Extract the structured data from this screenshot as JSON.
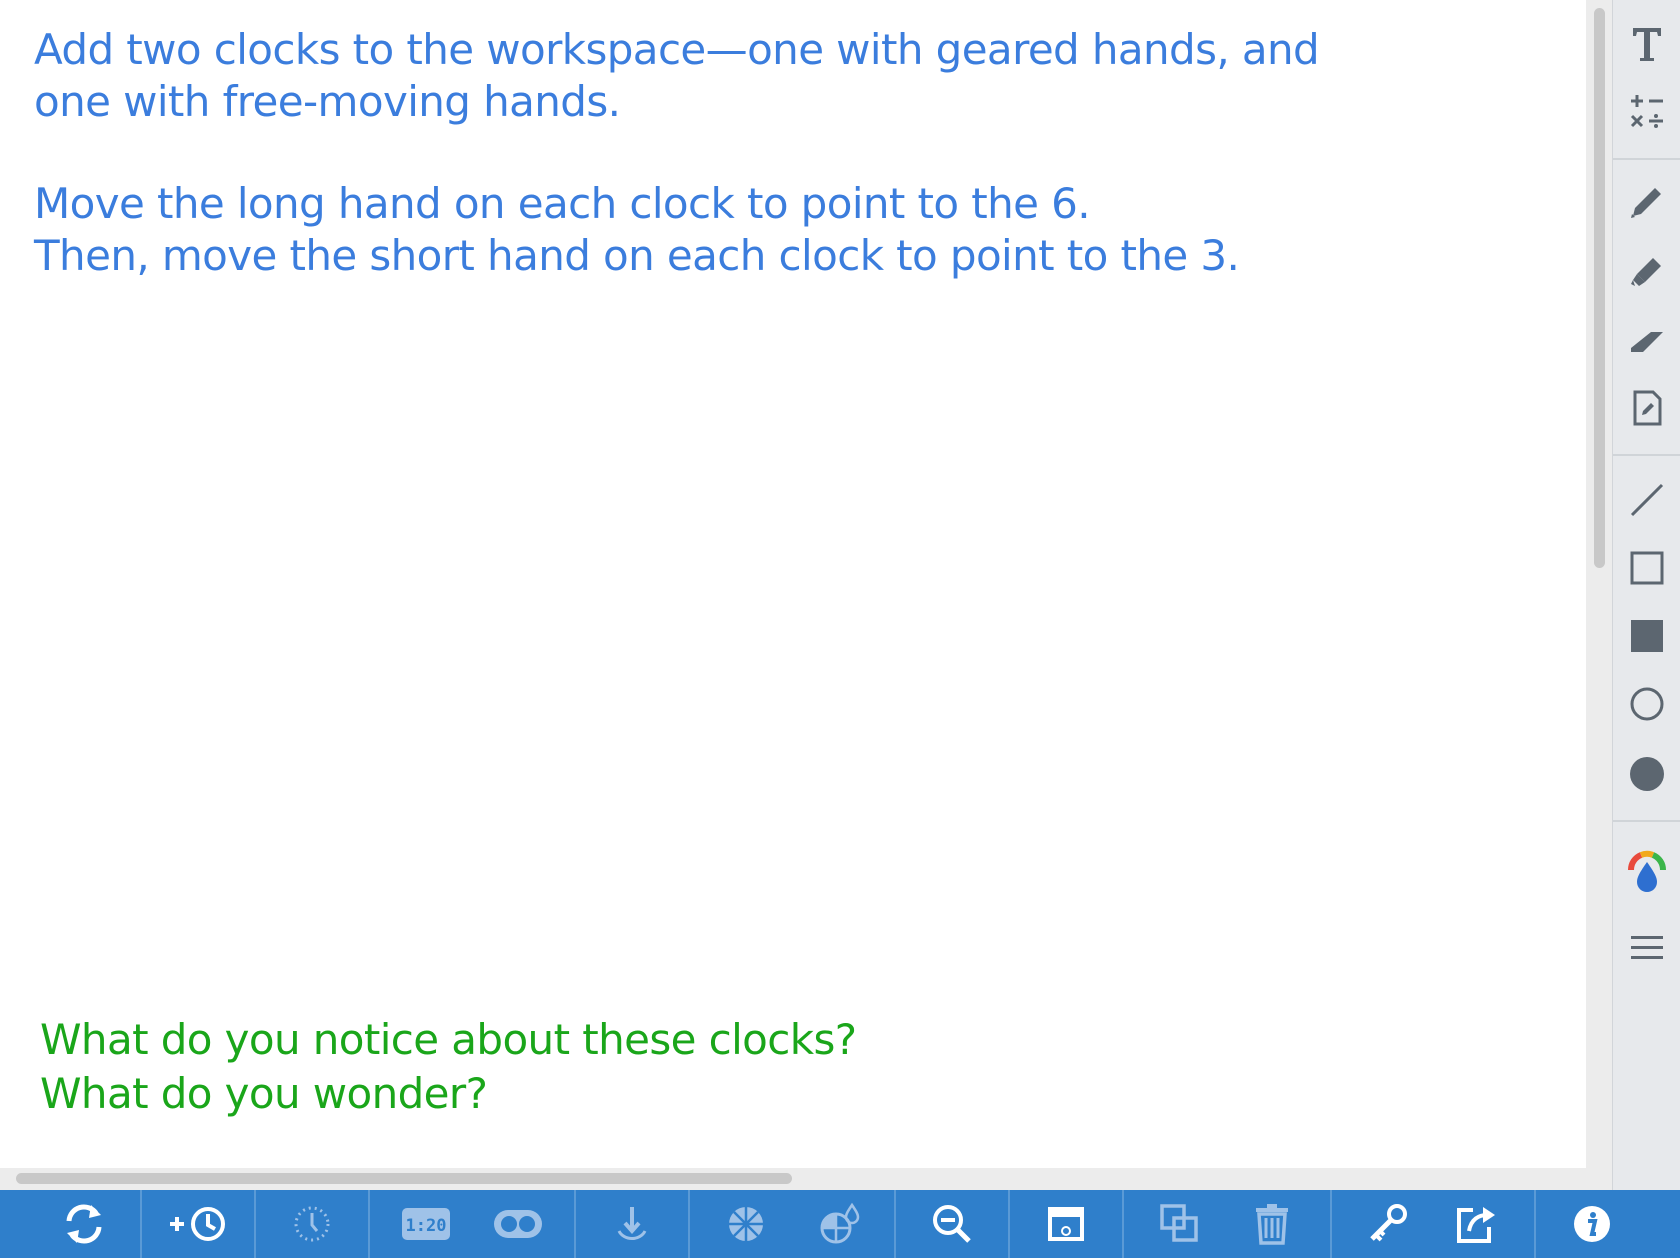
{
  "instructions": {
    "line1": "Add two clocks to the workspace—one with geared hands, and",
    "line2": "one with free-moving hands.",
    "line3": "Move the long hand on each clock to point to the 6.",
    "line4": "Then, move the short hand on each clock to point to the 3."
  },
  "prompt": {
    "line1": "What do you notice about these clocks?",
    "line2": "What do you wonder?"
  },
  "digital_clock_icon_text": "1:20",
  "colors": {
    "instruction_text": "#3b7ddd",
    "prompt_text": "#1aa61a",
    "bottom_toolbar": "#2f7fcb",
    "right_toolbar": "#e7e9ec",
    "icon_gray": "#5c6670"
  },
  "right_toolbar": {
    "items": [
      "text-icon",
      "math-symbols-icon",
      "pen-icon",
      "highlighter-icon",
      "eraser-icon",
      "note-icon",
      "line-icon",
      "rectangle-outline-icon",
      "rectangle-filled-icon",
      "circle-outline-icon",
      "circle-filled-icon",
      "color-picker-icon",
      "menu-icon"
    ]
  },
  "bottom_toolbar": {
    "items": [
      "reset-icon",
      "add-clock-icon",
      "clock-ticks-icon",
      "digital-clock-icon",
      "visibility-toggle-icon",
      "pointer-icon",
      "fraction-circle-icon",
      "fill-color-icon",
      "zoom-out-icon",
      "screenshot-icon",
      "duplicate-icon",
      "trash-icon",
      "key-icon",
      "share-icon",
      "info-icon"
    ]
  }
}
